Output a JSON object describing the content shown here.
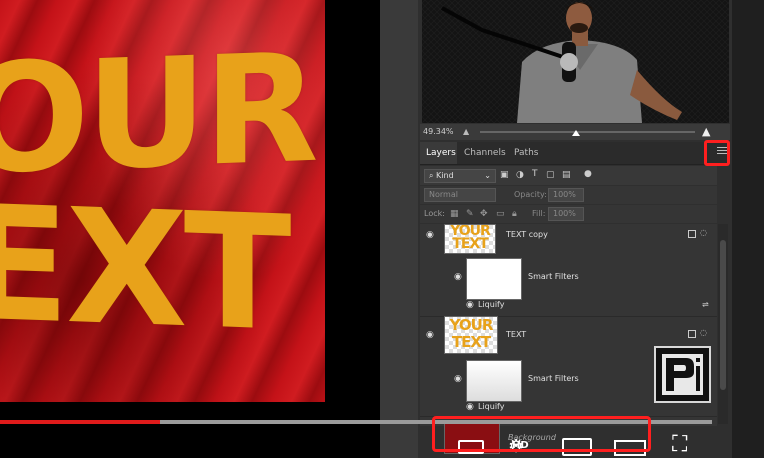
{
  "canvas": {
    "line1": "OUR",
    "line2": "EXT"
  },
  "photoshop": {
    "zoom": {
      "value": "49.34%"
    },
    "tabs": [
      "Layers",
      "Channels",
      "Paths"
    ],
    "filter": {
      "kind_label": "Kind"
    },
    "blend_mode": "Normal",
    "opacity_label": "Opacity:",
    "opacity_value": "100%",
    "lock_label": "Lock:",
    "fill_label": "Fill:",
    "fill_value": "100%",
    "layers": [
      {
        "name": "TEXT copy",
        "thumb_text": "YOUR TEXT",
        "smart_filters": "Smart Filters",
        "filter_name": "Liquify"
      },
      {
        "name": "TEXT",
        "thumb_text": "YOUR TEXT",
        "smart_filters": "Smart Filters",
        "filter_name": "Liquify"
      },
      {
        "name": "Background"
      }
    ]
  },
  "video": {
    "progress_fraction": 0.225,
    "hd_label": "HD"
  },
  "colors": {
    "highlight": "#ff1f1f",
    "flag_text": "#e8a21a",
    "flag_red": "#c41218",
    "progress_red": "#e01b1b"
  }
}
